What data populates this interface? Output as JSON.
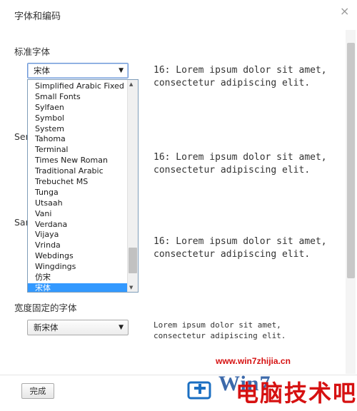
{
  "dialog": {
    "title": "字体和编码",
    "close_glyph": "×"
  },
  "standard_font": {
    "label": "标准字体",
    "selected": "宋体",
    "preview": [
      "16: Lorem ipsum dolor sit amet,",
      "consectetur adipiscing elit."
    ]
  },
  "serif_font": {
    "label_partial": "Ser",
    "preview": [
      "16: Lorem ipsum dolor sit amet,",
      "consectetur adipiscing elit."
    ]
  },
  "sans_font": {
    "label_partial": "Sar",
    "preview": [
      "16: Lorem ipsum dolor sit amet,",
      "consectetur adipiscing elit."
    ]
  },
  "fixed_font": {
    "label": "宽度固定的字体",
    "selected": "新宋体",
    "preview": [
      "Lorem ipsum dolor sit amet,",
      "consectetur adipiscing elit."
    ]
  },
  "font_dropdown": {
    "items": [
      "Simplified Arabic Fixed",
      "Small Fonts",
      "Sylfaen",
      "Symbol",
      "System",
      "Tahoma",
      "Terminal",
      "Times New Roman",
      "Traditional Arabic",
      "Trebuchet MS",
      "Tunga",
      "Utsaah",
      "Vani",
      "Verdana",
      "Vijaya",
      "Vrinda",
      "Webdings",
      "Wingdings",
      "仿宋",
      "宋体"
    ],
    "selected_index": 19
  },
  "done_button": {
    "label": "完成"
  },
  "watermark": {
    "url": "www.win7zhijia.cn",
    "brand": "Win7",
    "text": "电脑技术吧"
  },
  "icons": {
    "select_arrow": "caret-down-icon",
    "close": "close-icon"
  }
}
